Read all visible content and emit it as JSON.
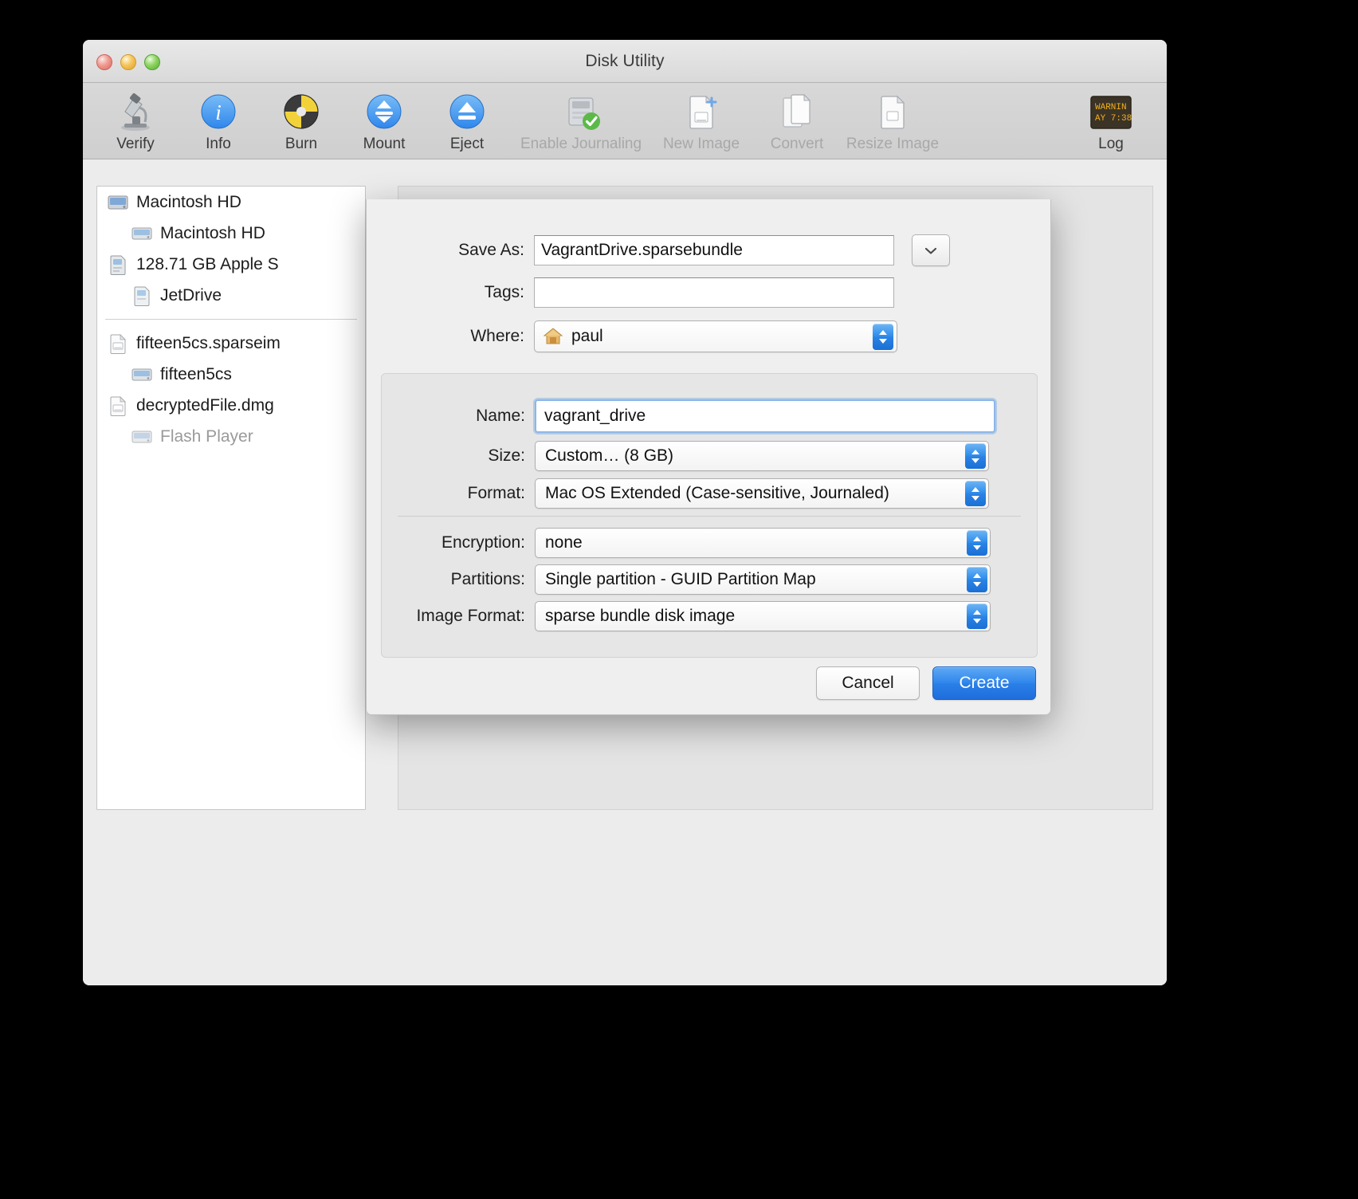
{
  "window": {
    "title": "Disk Utility",
    "traffic_lights": [
      "close-button",
      "minimize-button",
      "zoom-button"
    ]
  },
  "toolbar": {
    "items": [
      {
        "label": "Verify",
        "icon": "microscope-icon",
        "enabled": true
      },
      {
        "label": "Info",
        "icon": "info-icon",
        "enabled": true
      },
      {
        "label": "Burn",
        "icon": "burn-disc-icon",
        "enabled": true
      },
      {
        "label": "Mount",
        "icon": "mount-icon",
        "enabled": true
      },
      {
        "label": "Eject",
        "icon": "eject-icon",
        "enabled": true
      },
      {
        "label": "Enable Journaling",
        "icon": "journaling-icon",
        "enabled": false
      },
      {
        "label": "New Image",
        "icon": "new-image-icon",
        "enabled": false
      },
      {
        "label": "Convert",
        "icon": "convert-icon",
        "enabled": false
      },
      {
        "label": "Resize Image",
        "icon": "resize-image-icon",
        "enabled": false
      }
    ],
    "log": {
      "label": "Log",
      "icon": "log-icon"
    }
  },
  "sidebar": {
    "groups": [
      {
        "items": [
          {
            "label": "Macintosh HD",
            "icon": "internal-disk-icon",
            "indent": false,
            "dimmed": false
          },
          {
            "label": "Macintosh HD",
            "icon": "volume-icon",
            "indent": true,
            "dimmed": false
          },
          {
            "label": "128.71 GB Apple S",
            "icon": "card-disk-icon",
            "indent": false,
            "dimmed": false
          },
          {
            "label": "JetDrive",
            "icon": "card-volume-icon",
            "indent": true,
            "dimmed": false
          }
        ]
      },
      {
        "items": [
          {
            "label": "fifteen5cs.sparseim",
            "icon": "disk-image-icon",
            "indent": false,
            "dimmed": false
          },
          {
            "label": "fifteen5cs",
            "icon": "volume-icon",
            "indent": true,
            "dimmed": false
          },
          {
            "label": "decryptedFile.dmg",
            "icon": "disk-image-icon",
            "indent": false,
            "dimmed": false
          },
          {
            "label": "Flash Player",
            "icon": "volume-icon",
            "indent": true,
            "dimmed": true
          }
        ]
      }
    ]
  },
  "help_button": {
    "label": "?",
    "icon": "help-icon"
  },
  "sheet": {
    "save_as": {
      "label": "Save As:",
      "value": "VagrantDrive.sparsebundle",
      "placeholder": "",
      "disclosure_icon": "chevron-down-icon"
    },
    "tags": {
      "label": "Tags:",
      "value": "",
      "placeholder": ""
    },
    "where": {
      "label": "Where:",
      "value": "paul",
      "icon": "home-folder-icon"
    },
    "name": {
      "label": "Name:",
      "value": "vagrant_drive",
      "placeholder": ""
    },
    "size": {
      "label": "Size:",
      "value": "Custom… (8 GB)"
    },
    "format": {
      "label": "Format:",
      "value": "Mac OS Extended (Case-sensitive, Journaled)"
    },
    "encryption": {
      "label": "Encryption:",
      "value": "none"
    },
    "partitions": {
      "label": "Partitions:",
      "value": "Single partition - GUID Partition Map"
    },
    "image_format": {
      "label": "Image Format:",
      "value": "sparse bundle disk image"
    },
    "buttons": {
      "cancel": "Cancel",
      "create": "Create"
    }
  },
  "colors": {
    "accent_blue": "#2f86ec",
    "window_bg": "#ececec",
    "sheet_bg": "#efefef",
    "sidebar_bg": "#ffffff",
    "focus_ring": "#8cb7e8",
    "dimmed_text": "#a8a8a8"
  }
}
